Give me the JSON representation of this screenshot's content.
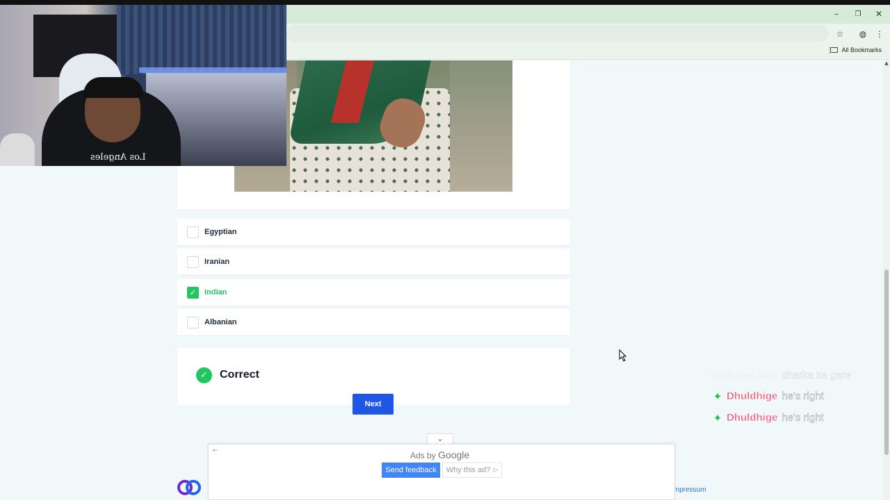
{
  "browser": {
    "bookmarks_label": "All Bookmarks",
    "minimize_glyph": "–",
    "restore_glyph": "❐",
    "close_glyph": "✕",
    "star_glyph": "☆",
    "menu_glyph": "⋮",
    "scroll_up_glyph": "▲"
  },
  "quiz": {
    "options": [
      {
        "label": "Egyptian",
        "checked": false
      },
      {
        "label": "Iranian",
        "checked": false
      },
      {
        "label": "Indian",
        "checked": true
      },
      {
        "label": "Albanian",
        "checked": false
      }
    ],
    "result_text": "Correct",
    "next_label": "Next",
    "check_glyph": "✓"
  },
  "footer": {
    "impressum_label": "Impressum"
  },
  "ad": {
    "collapse_glyph": "⌄",
    "back_glyph": "←",
    "ads_by_label": "Ads by",
    "google_label": "Google",
    "send_feedback_label": "Send feedback",
    "why_ad_label": "Why this ad?",
    "why_ad_glyph": "▷"
  },
  "webcam": {
    "shirt_text": "Los Angeles"
  },
  "chat": [
    {
      "user": "Burhaan.Jr26",
      "message": "dharka ka gare",
      "faded": true,
      "badge": ""
    },
    {
      "user": "Dhuldhige",
      "message": "he's right",
      "faded": false,
      "badge": "✦"
    },
    {
      "user": "Dhuldhige",
      "message": "he's right",
      "faded": false,
      "badge": "✦"
    }
  ],
  "colors": {
    "accent": "#1f56e6",
    "correct": "#22c55e",
    "chat_user": "#f25b7a"
  }
}
